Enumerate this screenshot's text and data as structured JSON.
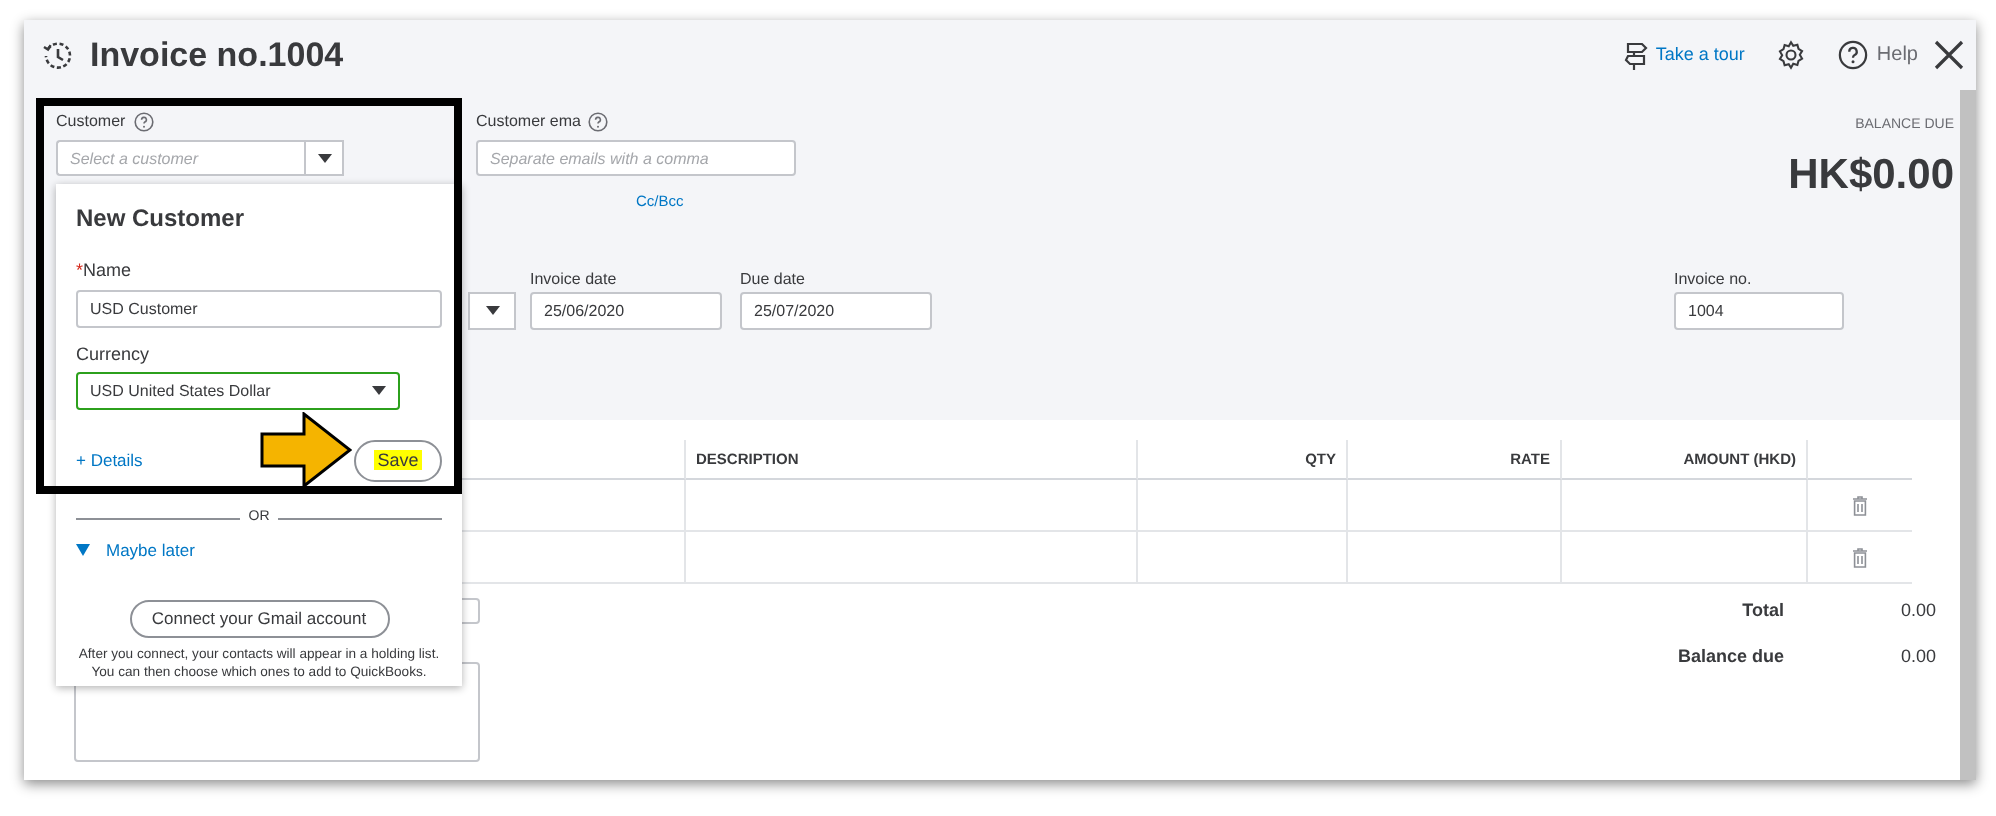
{
  "header": {
    "title": "Invoice no.1004",
    "tour_link": "Take a tour",
    "help_label": "Help"
  },
  "customer": {
    "label": "Customer",
    "placeholder": "Select a customer"
  },
  "email": {
    "label": "Customer ema",
    "placeholder": "Separate emails with a comma",
    "cc_link": "Cc/Bcc"
  },
  "balance": {
    "label": "BALANCE DUE",
    "amount": "HK$0.00"
  },
  "dates": [
    {
      "label": "Invoice date",
      "value": "25/06/2020"
    },
    {
      "label": "Due date",
      "value": "25/07/2020"
    }
  ],
  "invoice_no": {
    "label": "Invoice no.",
    "value": "1004"
  },
  "table": {
    "columns": [
      {
        "label": "DESCRIPTION",
        "kind": "text"
      },
      {
        "label": "QTY",
        "kind": "number"
      },
      {
        "label": "RATE",
        "kind": "number"
      },
      {
        "label": "AMOUNT (HKD)",
        "kind": "number"
      }
    ],
    "rows": [
      {
        "deletable": true
      },
      {
        "deletable": true
      }
    ]
  },
  "totals": [
    {
      "label": "Total",
      "value": "0.00"
    },
    {
      "label": "Balance due",
      "value": "0.00"
    }
  ],
  "new_customer": {
    "title": "New Customer",
    "required_mark": "*",
    "name_label": "Name",
    "name_value": "USD Customer",
    "currency_label": "Currency",
    "currency_value": "USD United States Dollar",
    "details_link": "+ Details",
    "save_button": "Save",
    "divider": "OR",
    "maybe_later": "Maybe later",
    "maybe_expanded": true,
    "gmail_button": "Connect your Gmail account",
    "note_lines": [
      "After you connect, your contacts will appear in a holding list.",
      "You can then choose which ones to add to QuickBooks."
    ]
  }
}
